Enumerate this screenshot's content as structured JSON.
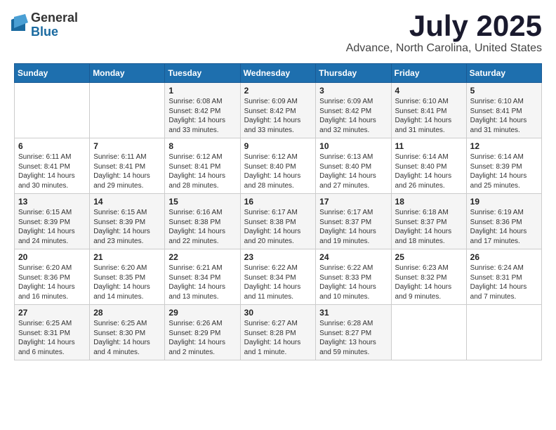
{
  "logo": {
    "general": "General",
    "blue": "Blue"
  },
  "title": "July 2025",
  "location": "Advance, North Carolina, United States",
  "days_header": [
    "Sunday",
    "Monday",
    "Tuesday",
    "Wednesday",
    "Thursday",
    "Friday",
    "Saturday"
  ],
  "weeks": [
    [
      {
        "num": "",
        "info": ""
      },
      {
        "num": "",
        "info": ""
      },
      {
        "num": "1",
        "info": "Sunrise: 6:08 AM\nSunset: 8:42 PM\nDaylight: 14 hours and 33 minutes."
      },
      {
        "num": "2",
        "info": "Sunrise: 6:09 AM\nSunset: 8:42 PM\nDaylight: 14 hours and 33 minutes."
      },
      {
        "num": "3",
        "info": "Sunrise: 6:09 AM\nSunset: 8:42 PM\nDaylight: 14 hours and 32 minutes."
      },
      {
        "num": "4",
        "info": "Sunrise: 6:10 AM\nSunset: 8:41 PM\nDaylight: 14 hours and 31 minutes."
      },
      {
        "num": "5",
        "info": "Sunrise: 6:10 AM\nSunset: 8:41 PM\nDaylight: 14 hours and 31 minutes."
      }
    ],
    [
      {
        "num": "6",
        "info": "Sunrise: 6:11 AM\nSunset: 8:41 PM\nDaylight: 14 hours and 30 minutes."
      },
      {
        "num": "7",
        "info": "Sunrise: 6:11 AM\nSunset: 8:41 PM\nDaylight: 14 hours and 29 minutes."
      },
      {
        "num": "8",
        "info": "Sunrise: 6:12 AM\nSunset: 8:41 PM\nDaylight: 14 hours and 28 minutes."
      },
      {
        "num": "9",
        "info": "Sunrise: 6:12 AM\nSunset: 8:40 PM\nDaylight: 14 hours and 28 minutes."
      },
      {
        "num": "10",
        "info": "Sunrise: 6:13 AM\nSunset: 8:40 PM\nDaylight: 14 hours and 27 minutes."
      },
      {
        "num": "11",
        "info": "Sunrise: 6:14 AM\nSunset: 8:40 PM\nDaylight: 14 hours and 26 minutes."
      },
      {
        "num": "12",
        "info": "Sunrise: 6:14 AM\nSunset: 8:39 PM\nDaylight: 14 hours and 25 minutes."
      }
    ],
    [
      {
        "num": "13",
        "info": "Sunrise: 6:15 AM\nSunset: 8:39 PM\nDaylight: 14 hours and 24 minutes."
      },
      {
        "num": "14",
        "info": "Sunrise: 6:15 AM\nSunset: 8:39 PM\nDaylight: 14 hours and 23 minutes."
      },
      {
        "num": "15",
        "info": "Sunrise: 6:16 AM\nSunset: 8:38 PM\nDaylight: 14 hours and 22 minutes."
      },
      {
        "num": "16",
        "info": "Sunrise: 6:17 AM\nSunset: 8:38 PM\nDaylight: 14 hours and 20 minutes."
      },
      {
        "num": "17",
        "info": "Sunrise: 6:17 AM\nSunset: 8:37 PM\nDaylight: 14 hours and 19 minutes."
      },
      {
        "num": "18",
        "info": "Sunrise: 6:18 AM\nSunset: 8:37 PM\nDaylight: 14 hours and 18 minutes."
      },
      {
        "num": "19",
        "info": "Sunrise: 6:19 AM\nSunset: 8:36 PM\nDaylight: 14 hours and 17 minutes."
      }
    ],
    [
      {
        "num": "20",
        "info": "Sunrise: 6:20 AM\nSunset: 8:36 PM\nDaylight: 14 hours and 16 minutes."
      },
      {
        "num": "21",
        "info": "Sunrise: 6:20 AM\nSunset: 8:35 PM\nDaylight: 14 hours and 14 minutes."
      },
      {
        "num": "22",
        "info": "Sunrise: 6:21 AM\nSunset: 8:34 PM\nDaylight: 14 hours and 13 minutes."
      },
      {
        "num": "23",
        "info": "Sunrise: 6:22 AM\nSunset: 8:34 PM\nDaylight: 14 hours and 11 minutes."
      },
      {
        "num": "24",
        "info": "Sunrise: 6:22 AM\nSunset: 8:33 PM\nDaylight: 14 hours and 10 minutes."
      },
      {
        "num": "25",
        "info": "Sunrise: 6:23 AM\nSunset: 8:32 PM\nDaylight: 14 hours and 9 minutes."
      },
      {
        "num": "26",
        "info": "Sunrise: 6:24 AM\nSunset: 8:31 PM\nDaylight: 14 hours and 7 minutes."
      }
    ],
    [
      {
        "num": "27",
        "info": "Sunrise: 6:25 AM\nSunset: 8:31 PM\nDaylight: 14 hours and 6 minutes."
      },
      {
        "num": "28",
        "info": "Sunrise: 6:25 AM\nSunset: 8:30 PM\nDaylight: 14 hours and 4 minutes."
      },
      {
        "num": "29",
        "info": "Sunrise: 6:26 AM\nSunset: 8:29 PM\nDaylight: 14 hours and 2 minutes."
      },
      {
        "num": "30",
        "info": "Sunrise: 6:27 AM\nSunset: 8:28 PM\nDaylight: 14 hours and 1 minute."
      },
      {
        "num": "31",
        "info": "Sunrise: 6:28 AM\nSunset: 8:27 PM\nDaylight: 13 hours and 59 minutes."
      },
      {
        "num": "",
        "info": ""
      },
      {
        "num": "",
        "info": ""
      }
    ]
  ]
}
